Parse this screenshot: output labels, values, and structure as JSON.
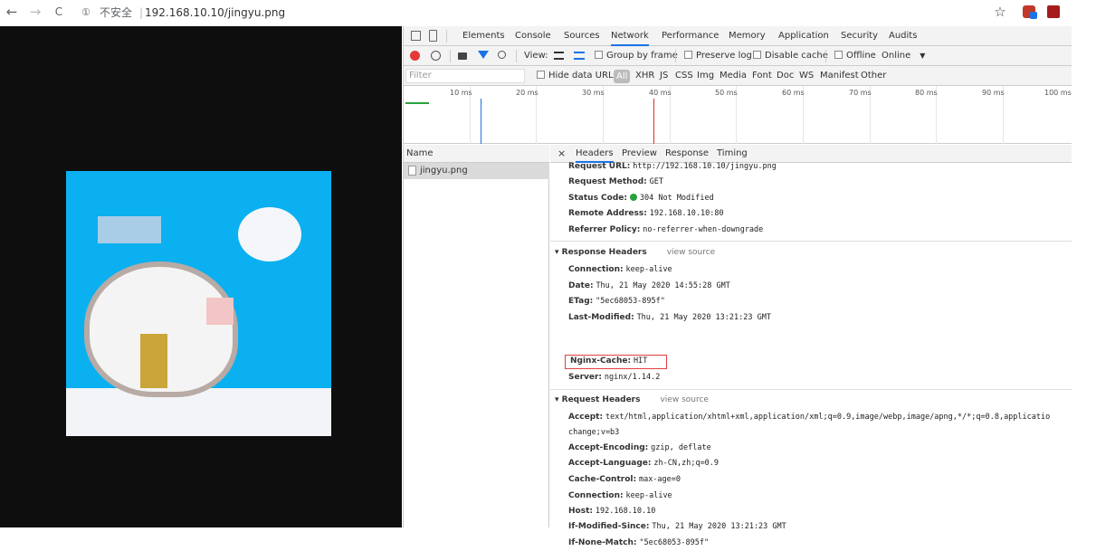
{
  "browser": {
    "back_icon": "←",
    "forward_icon": "→",
    "reload_icon": "C",
    "info_icon": "①",
    "insecure_label": "不安全",
    "separator": "|",
    "url": "192.168.10.10/jingyu.png",
    "star_icon": "☆"
  },
  "devtools": {
    "tabs": [
      "Elements",
      "Console",
      "Sources",
      "Network",
      "Performance",
      "Memory",
      "Application",
      "Security",
      "Audits"
    ],
    "active_tab": "Network",
    "toolbar": {
      "view_label": "View:",
      "group_by_frame": "Group by frame",
      "preserve_log": "Preserve log",
      "disable_cache": "Disable cache",
      "offline": "Offline",
      "online": "Online"
    },
    "filter": {
      "placeholder": "Filter",
      "hide_data_urls": "Hide data URLs",
      "types": [
        "All",
        "XHR",
        "JS",
        "CSS",
        "Img",
        "Media",
        "Font",
        "Doc",
        "WS",
        "Manifest",
        "Other"
      ]
    },
    "timeline_ticks": [
      "10 ms",
      "20 ms",
      "30 ms",
      "40 ms",
      "50 ms",
      "60 ms",
      "70 ms",
      "80 ms",
      "90 ms",
      "100 ms"
    ],
    "name_header": "Name",
    "request_name": "jingyu.png",
    "detail_tabs": [
      "×",
      "Headers",
      "Preview",
      "Response",
      "Timing"
    ],
    "general": [
      {
        "key": "Request URL:",
        "value": "http://192.168.10.10/jingyu.png"
      },
      {
        "key": "Request Method:",
        "value": "GET"
      },
      {
        "key": "Status Code:",
        "value": "304 Not Modified"
      },
      {
        "key": "Remote Address:",
        "value": "192.168.10.10:80"
      },
      {
        "key": "Referrer Policy:",
        "value": "no-referrer-when-downgrade"
      }
    ],
    "response_headers_title": "▾ Response Headers",
    "view_source": "view source",
    "response_headers": [
      {
        "key": "Connection:",
        "value": "keep-alive"
      },
      {
        "key": "Date:",
        "value": "Thu, 21 May 2020 14:55:28 GMT"
      },
      {
        "key": "ETag:",
        "value": "\"5ec68053-895f\""
      },
      {
        "key": "Last-Modified:",
        "value": "Thu, 21 May 2020 13:21:23 GMT"
      },
      {
        "key": "Nginx-Cache:",
        "value": "HIT"
      },
      {
        "key": "Server:",
        "value": "nginx/1.14.2"
      }
    ],
    "request_headers_title": "▾ Request Headers",
    "request_headers": [
      {
        "key": "Accept:",
        "value": "text/html,application/xhtml+xml,application/xml;q=0.9,image/webp,image/apng,*/*;q=0.8,applicatio"
      },
      {
        "key": "",
        "value": "change;v=b3"
      },
      {
        "key": "Accept-Encoding:",
        "value": "gzip, deflate"
      },
      {
        "key": "Accept-Language:",
        "value": "zh-CN,zh;q=0.9"
      },
      {
        "key": "Cache-Control:",
        "value": "max-age=0"
      },
      {
        "key": "Connection:",
        "value": "keep-alive"
      },
      {
        "key": "Host:",
        "value": "192.168.10.10"
      },
      {
        "key": "If-Modified-Since:",
        "value": "Thu, 21 May 2020 13:21:23 GMT"
      },
      {
        "key": "If-None-Match:",
        "value": "\"5ec68053-895f\""
      }
    ]
  }
}
